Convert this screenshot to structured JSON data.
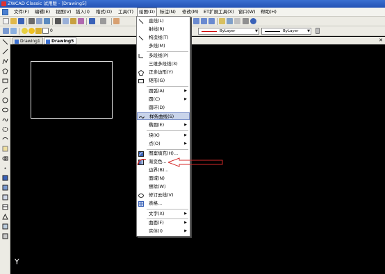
{
  "window": {
    "title": "ZWCAD Classic 试用版 - [Drawing5]"
  },
  "menubar": {
    "items": [
      "文件(F)",
      "编辑(E)",
      "视图(V)",
      "插入(I)",
      "格式(O)",
      "工具(T)",
      "绘图(D)",
      "标注(N)",
      "修改(M)",
      "ET扩展工具(X)",
      "窗口(W)",
      "帮助(H)"
    ],
    "active_index": 6
  },
  "toolbar": {
    "layer_value": "0",
    "linetype_value": "ByLayer",
    "lineweight_value": "ByLayer"
  },
  "tabs": [
    "Drawing1",
    "Drawing5"
  ],
  "active_tab": 1,
  "canvas": {
    "ucs_label": "Y"
  },
  "draw_menu": {
    "items": [
      {
        "label": "直线(L)",
        "icon": "line-icon"
      },
      {
        "label": "射线(R)",
        "icon": ""
      },
      {
        "label": "构造线(T)",
        "icon": "xline-icon"
      },
      {
        "label": "多线(M)",
        "icon": ""
      },
      {
        "label": "多段线(P)",
        "icon": "polyline-icon"
      },
      {
        "label": "三维多段线(3)",
        "icon": ""
      },
      {
        "label": "正多边形(Y)",
        "icon": "polygon-icon"
      },
      {
        "label": "矩形(G)",
        "icon": "rectangle-icon"
      },
      {
        "label": "圆弧(A)",
        "icon": "",
        "submenu": true
      },
      {
        "label": "圆(C)",
        "icon": "",
        "submenu": true
      },
      {
        "label": "圆环(D)",
        "icon": ""
      },
      {
        "label": "样条曲线(S)",
        "icon": "spline-icon",
        "highlight": true
      },
      {
        "label": "椭圆(E)",
        "icon": "",
        "submenu": true
      },
      {
        "label": "块(K)",
        "icon": "",
        "submenu": true
      },
      {
        "label": "点(O)",
        "icon": "",
        "submenu": true
      },
      {
        "label": "图案填充(H)...",
        "icon": "hatch-icon"
      },
      {
        "label": "渐变色...",
        "icon": "gradient-icon"
      },
      {
        "label": "边界(B)...",
        "icon": ""
      },
      {
        "label": "面域(N)",
        "icon": ""
      },
      {
        "label": "擦除(W)",
        "icon": ""
      },
      {
        "label": "修订云线(V)",
        "icon": "revcloud-icon"
      },
      {
        "label": "表格...",
        "icon": "table-icon"
      },
      {
        "label": "文字(X)",
        "icon": "",
        "submenu": true
      },
      {
        "label": "曲面(F)",
        "icon": "",
        "submenu": true
      },
      {
        "label": "实体(I)",
        "icon": "",
        "submenu": true
      }
    ]
  },
  "colors": {
    "title_bar": "#2a5cc0",
    "menu_highlight": "#c9d4ea",
    "canvas": "#000000",
    "annotation": "#d42a2a"
  }
}
